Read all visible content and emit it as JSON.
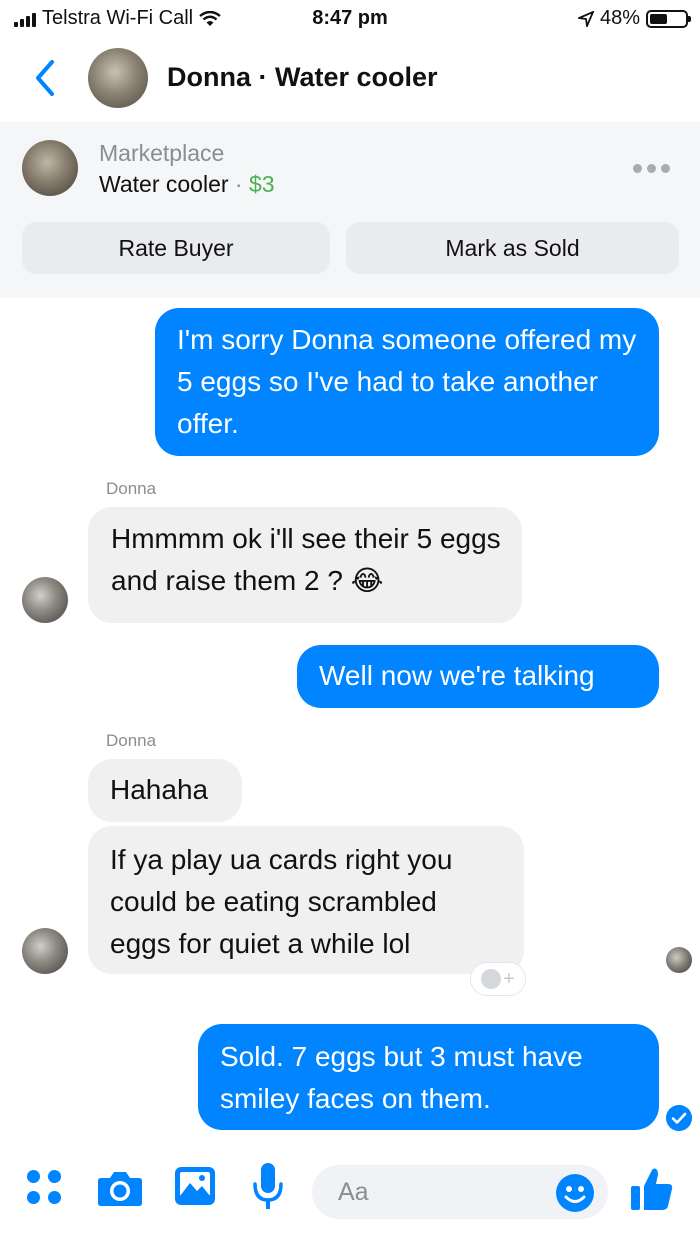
{
  "status_bar": {
    "carrier": "Telstra Wi-Fi Call",
    "time": "8:47 pm",
    "battery": "48%"
  },
  "header": {
    "title": "Donna · Water cooler"
  },
  "marketplace": {
    "section": "Marketplace",
    "item_name": "Water cooler",
    "separator": " · ",
    "price": "$3",
    "rate_buyer_label": "Rate Buyer",
    "mark_sold_label": "Mark as Sold"
  },
  "messages": [
    {
      "from": "me",
      "text": "I'm sorry Donna someone offered my 5 eggs so I've had to take another offer."
    },
    {
      "from": "Donna",
      "sender_label": "Donna",
      "text": "Hmmmm ok i'll see their 5 eggs and raise them 2 ? 😂"
    },
    {
      "from": "me",
      "text": "Well now we're talking"
    },
    {
      "from": "Donna",
      "sender_label": "Donna",
      "text": "Hahaha"
    },
    {
      "from": "Donna",
      "text": "If ya play ua cards right you could be eating scrambled eggs for quiet a while lol"
    },
    {
      "from": "me",
      "text": "Sold. 7 eggs but 3 must have smiley faces on them."
    }
  ],
  "reaction_add": "+",
  "composer": {
    "placeholder": "Aa"
  },
  "colors": {
    "accent": "#0084ff",
    "incoming_bubble": "#f0f0f0",
    "price_green": "#4cb050"
  },
  "icons": [
    "back-chevron-icon",
    "more-dots-icon",
    "apps-grid-icon",
    "camera-icon",
    "gallery-icon",
    "microphone-icon",
    "emoji-icon",
    "like-thumb-icon",
    "delivered-check-icon",
    "add-reaction-icon"
  ]
}
